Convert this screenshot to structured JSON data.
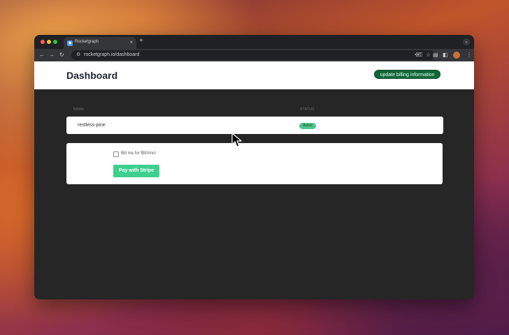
{
  "browser": {
    "tab_title": "Rocketgraph",
    "tab_close_glyph": "×",
    "new_tab_glyph": "+",
    "url": "rocketgraph.io/dashboard",
    "icons": {
      "back": "arrow-left-icon",
      "forward": "arrow-right-icon",
      "reload": "reload-icon",
      "site_info": "site-info-icon",
      "password": "key-icon",
      "bookmark": "star-icon",
      "extensions": "puzzle-icon",
      "menu": "kebab-menu-icon"
    }
  },
  "header": {
    "title": "Dashboard",
    "billing_button_label": "update billing information"
  },
  "table": {
    "columns": [
      "NAME",
      "STATUS"
    ],
    "rows": [
      {
        "name": "restless-pine",
        "status": "Active"
      }
    ]
  },
  "billing": {
    "checkbox_label": "Bill me for $50/mo!",
    "checked": false,
    "pay_button_label": "Pay with Stripe"
  },
  "colors": {
    "billing_button_bg": "#12673a",
    "pay_button_bg": "#3ecf8e",
    "status_badge_bg": "#4fc58a",
    "page_bg": "#262626"
  }
}
